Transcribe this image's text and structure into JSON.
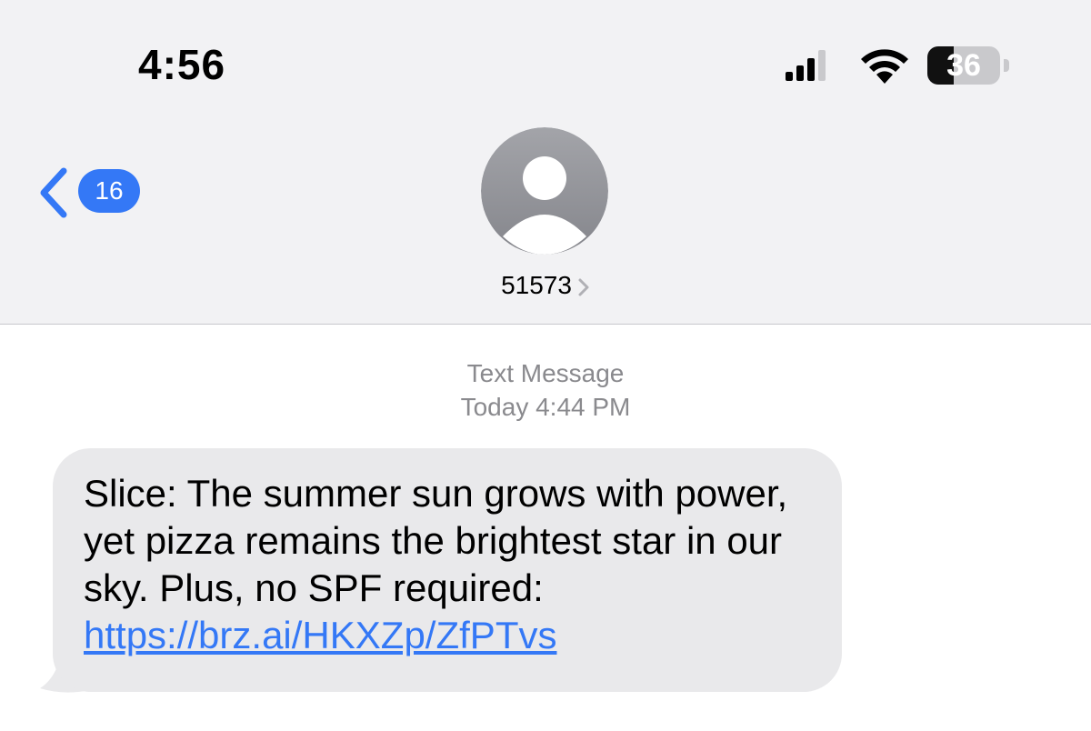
{
  "status_bar": {
    "time": "4:56",
    "battery_level": "36",
    "battery_fraction": 0.36,
    "icons": [
      "cellular-signal-icon",
      "wifi-icon",
      "battery-icon"
    ]
  },
  "nav": {
    "back_count": "16",
    "contact_name": "51573"
  },
  "conversation": {
    "service_label": "Text Message",
    "timestamp": "Today 4:44 PM",
    "message": {
      "text": "Slice: The summer sun grows with power, yet pizza remains the brightest star in our sky. Plus, no SPF required:",
      "link": "https://brz.ai/HKXZp/ZfPTvs"
    }
  },
  "colors": {
    "accent": "#3478f6",
    "header_bg": "#f2f2f4",
    "bubble_bg": "#e9e9eb",
    "meta_text": "#8a8a8e"
  }
}
